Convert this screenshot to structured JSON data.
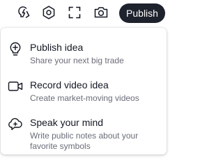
{
  "toolbar": {
    "icons": [
      "ideas-bulb-icon",
      "settings-hexagon-icon",
      "fullscreen-icon",
      "camera-icon"
    ],
    "publish_label": "Publish"
  },
  "menu": {
    "items": [
      {
        "icon": "bulb-plus-icon",
        "title": "Publish idea",
        "description": "Share your next big trade"
      },
      {
        "icon": "video-camera-icon",
        "title": "Record video idea",
        "description": "Create market-moving videos"
      },
      {
        "icon": "cloud-speech-icon",
        "title": "Speak your mind",
        "description": "Write public notes about your favorite symbols"
      }
    ]
  }
}
